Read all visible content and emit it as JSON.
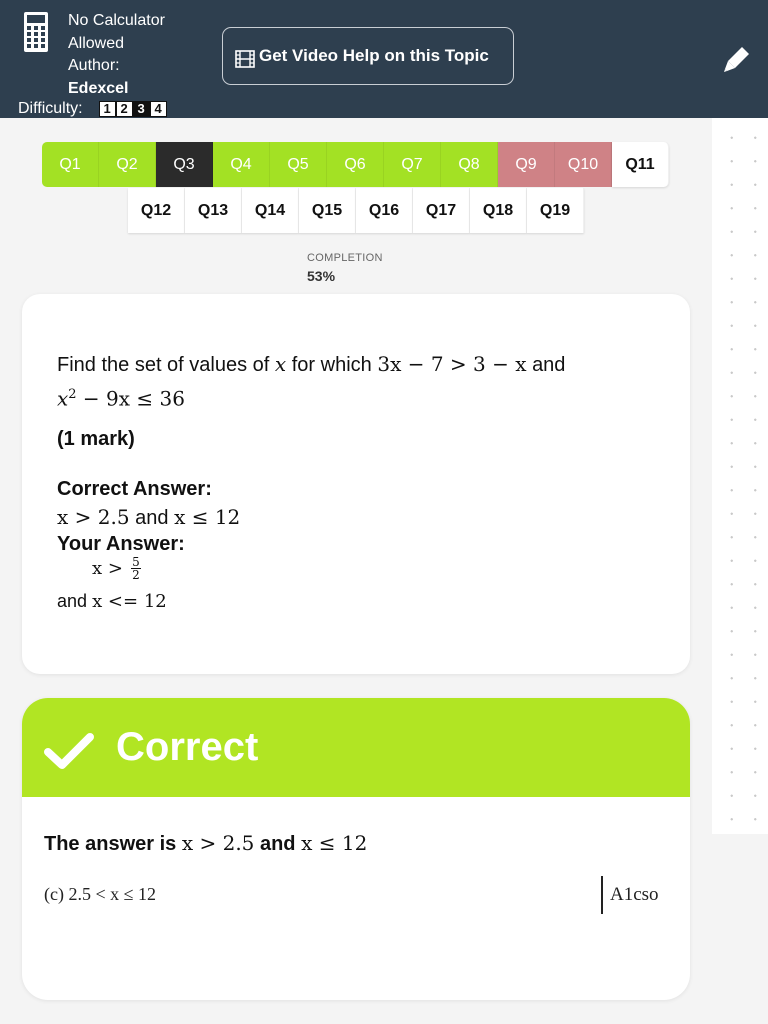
{
  "header": {
    "calculator_label_line1": "No Calculator",
    "calculator_label_line2": "Allowed",
    "author_label": "Author:",
    "author_name": "Edexcel",
    "difficulty_label": "Difficulty:",
    "difficulty_levels": [
      "1",
      "2",
      "3",
      "4"
    ],
    "difficulty_selected": 3,
    "video_button_label": "Get Video Help on this Topic",
    "icons": {
      "calculator": "calculator-icon",
      "video": "film-icon",
      "pen": "pen-icon"
    },
    "background_color": "#2e3f4f"
  },
  "question_nav": {
    "row1": [
      {
        "label": "Q1",
        "state": "correct"
      },
      {
        "label": "Q2",
        "state": "correct"
      },
      {
        "label": "Q3",
        "state": "current"
      },
      {
        "label": "Q4",
        "state": "correct"
      },
      {
        "label": "Q5",
        "state": "correct"
      },
      {
        "label": "Q6",
        "state": "correct"
      },
      {
        "label": "Q7",
        "state": "correct"
      },
      {
        "label": "Q8",
        "state": "correct"
      },
      {
        "label": "Q9",
        "state": "incorrect"
      },
      {
        "label": "Q10",
        "state": "incorrect"
      },
      {
        "label": "Q11",
        "state": "unanswered"
      }
    ],
    "row2": [
      {
        "label": "Q12",
        "state": "unanswered"
      },
      {
        "label": "Q13",
        "state": "unanswered"
      },
      {
        "label": "Q14",
        "state": "unanswered"
      },
      {
        "label": "Q15",
        "state": "unanswered"
      },
      {
        "label": "Q16",
        "state": "unanswered"
      },
      {
        "label": "Q17",
        "state": "unanswered"
      },
      {
        "label": "Q18",
        "state": "unanswered"
      },
      {
        "label": "Q19",
        "state": "unanswered"
      }
    ],
    "colors": {
      "correct": "#a3e124",
      "current": "#2b2b2b",
      "incorrect": "#cf8286",
      "unanswered": "#ffffff"
    }
  },
  "completion": {
    "label": "COMPLETION",
    "value": "53%"
  },
  "question": {
    "text_prefix": "Find the set of values of",
    "var_x": "x",
    "text_mid": "for which",
    "ineq1": "3x − 7 > 3 − x",
    "text_and": "and",
    "ineq2_base": "x",
    "ineq2_exp": "2",
    "ineq2_rest": " − 9x ≤ 36",
    "marks": "(1 mark)"
  },
  "correct_answer": {
    "label": "Correct Answer:",
    "part1": "x > 2.5",
    "and": "and",
    "part2": "x ≤ 12"
  },
  "your_answer": {
    "label": "Your Answer:",
    "part1": "x >",
    "frac_num": "5",
    "frac_den": "2",
    "and": "and",
    "part2": "x <= 12"
  },
  "feedback": {
    "title": "Correct",
    "answer_prefix": "The answer is",
    "answer_part1": "x > 2.5",
    "and": "and",
    "answer_part2": "x ≤ 12",
    "markscheme_left": "(c)   2.5 < x ≤ 12",
    "markscheme_right": "A1cso",
    "icon": "check-icon",
    "header_color": "#b1e523"
  }
}
